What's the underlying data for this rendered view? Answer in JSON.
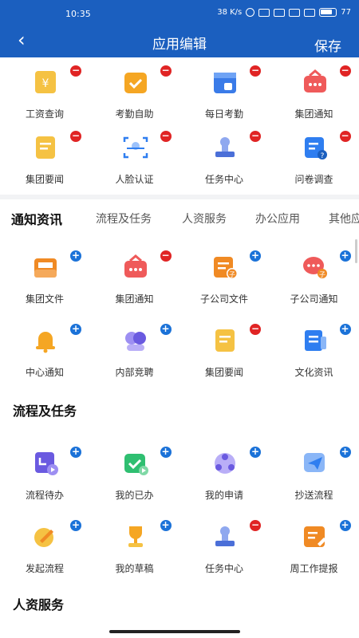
{
  "status_bar": {
    "time": "10:35",
    "net_speed": "38 K/s",
    "battery": "77"
  },
  "navbar": {
    "back_glyph": "‹",
    "title": "应用编辑",
    "save_label": "保存"
  },
  "my_apps": [
    {
      "label": "工资查询",
      "icon": "salary-icon",
      "color": "#f5c243",
      "action": "minus"
    },
    {
      "label": "考勤自助",
      "icon": "checkin-icon",
      "color": "#f5a623",
      "action": "minus"
    },
    {
      "label": "每日考勤",
      "icon": "calendar-icon",
      "color": "#3a7be8",
      "action": "minus"
    },
    {
      "label": "集团通知",
      "icon": "notice-icon",
      "color": "#ef5a5a",
      "action": "minus"
    },
    {
      "label": "集团要闻",
      "icon": "news-icon",
      "color": "#f5c243",
      "action": "minus"
    },
    {
      "label": "人脸认证",
      "icon": "face-icon",
      "color": "#2f7ef0",
      "action": "minus"
    },
    {
      "label": "任务中心",
      "icon": "stamp-icon",
      "color": "#4b6fd8",
      "action": "minus"
    },
    {
      "label": "问卷调查",
      "icon": "survey-icon",
      "color": "#2f7ef0",
      "action": "minus"
    }
  ],
  "tabs": [
    "通知资讯",
    "流程及任务",
    "人资服务",
    "办公应用",
    "其他应"
  ],
  "sections": [
    {
      "title": "通知资讯",
      "items": [
        {
          "label": "集团文件",
          "icon": "folder-icon",
          "color": "#f08a24",
          "action": "plus"
        },
        {
          "label": "集团通知",
          "icon": "notice-icon",
          "color": "#ef5a5a",
          "action": "minus"
        },
        {
          "label": "子公司文件",
          "icon": "sub-file-icon",
          "color": "#f08a24",
          "action": "plus"
        },
        {
          "label": "子公司通知",
          "icon": "sub-notice-icon",
          "color": "#ef5a5a",
          "action": "plus"
        },
        {
          "label": "中心通知",
          "icon": "bell-icon",
          "color": "#f5a623",
          "action": "plus"
        },
        {
          "label": "内部竞聘",
          "icon": "people-icon",
          "color": "#6a5ae0",
          "action": "plus"
        },
        {
          "label": "集团要闻",
          "icon": "news-icon",
          "color": "#f5c243",
          "action": "minus"
        },
        {
          "label": "文化资讯",
          "icon": "culture-icon",
          "color": "#2f7ef0",
          "action": "plus"
        }
      ]
    },
    {
      "title": "流程及任务",
      "items": [
        {
          "label": "流程待办",
          "icon": "todo-icon",
          "color": "#6a5ae0",
          "action": "plus"
        },
        {
          "label": "我的已办",
          "icon": "done-icon",
          "color": "#2fbf71",
          "action": "plus"
        },
        {
          "label": "我的申请",
          "icon": "apply-icon",
          "color": "#6a5ae0",
          "action": "plus"
        },
        {
          "label": "抄送流程",
          "icon": "send-icon",
          "color": "#2f7ef0",
          "action": "plus"
        },
        {
          "label": "发起流程",
          "icon": "edit-icon",
          "color": "#f5c243",
          "action": "plus"
        },
        {
          "label": "我的草稿",
          "icon": "trophy-icon",
          "color": "#f5a623",
          "action": "plus"
        },
        {
          "label": "任务中心",
          "icon": "stamp-icon",
          "color": "#4b6fd8",
          "action": "minus"
        },
        {
          "label": "周工作提报",
          "icon": "report-icon",
          "color": "#f08a24",
          "action": "plus"
        }
      ]
    },
    {
      "title": "人资服务",
      "items": []
    }
  ]
}
